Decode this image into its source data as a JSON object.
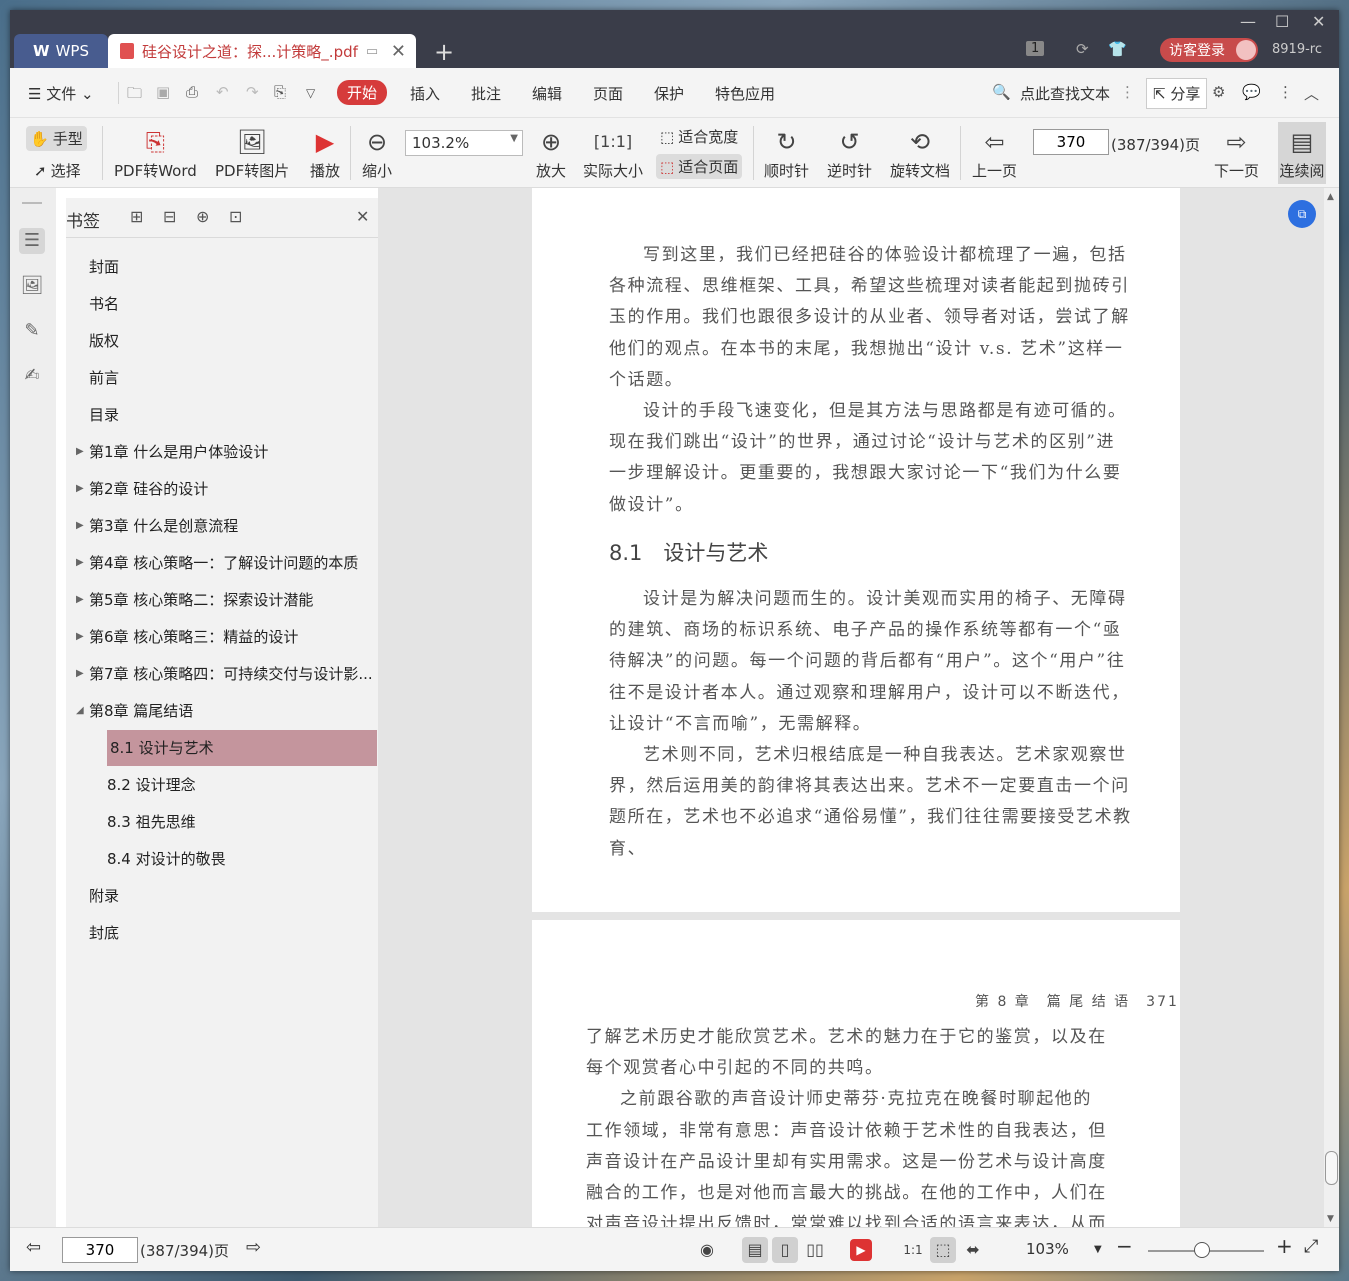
{
  "titlebar": {
    "wps_tab": "WPS",
    "doc_tab": "硅谷设计之道：探...计策略_.pdf",
    "badge": "1",
    "login": "访客登录",
    "user": "8919-rc"
  },
  "menu": {
    "file": "文件",
    "items": [
      "开始",
      "插入",
      "批注",
      "编辑",
      "页面",
      "保护",
      "特色应用"
    ],
    "search": "点此查找文本",
    "share": "分享"
  },
  "toolbar": {
    "hand": "手型",
    "select": "选择",
    "pdf2word": "PDF转Word",
    "pdf2img": "PDF转图片",
    "play": "播放",
    "zoom_out": "缩小",
    "zoom_value": "103.2%",
    "zoom_in": "放大",
    "actual_size": "实际大小",
    "fit_width": "适合宽度",
    "fit_page": "适合页面",
    "clockwise": "顺时针",
    "counter": "逆时针",
    "rotate": "旋转文档",
    "prev": "上一页",
    "page_num": "370",
    "page_total": "(387/394)页",
    "next": "下一页",
    "continuous": "连续阅"
  },
  "bookmark": {
    "title": "书签",
    "items": [
      {
        "label": "封面",
        "level": 0,
        "arrow": ""
      },
      {
        "label": "书名",
        "level": 0,
        "arrow": ""
      },
      {
        "label": "版权",
        "level": 0,
        "arrow": ""
      },
      {
        "label": "前言",
        "level": 0,
        "arrow": ""
      },
      {
        "label": "目录",
        "level": 0,
        "arrow": ""
      },
      {
        "label": "第1章 什么是用户体验设计",
        "level": 0,
        "arrow": "▶"
      },
      {
        "label": "第2章 硅谷的设计",
        "level": 0,
        "arrow": "▶"
      },
      {
        "label": "第3章 什么是创意流程",
        "level": 0,
        "arrow": "▶"
      },
      {
        "label": "第4章 核心策略一：了解设计问题的本质",
        "level": 0,
        "arrow": "▶"
      },
      {
        "label": "第5章 核心策略二：探索设计潜能",
        "level": 0,
        "arrow": "▶"
      },
      {
        "label": "第6章 核心策略三：精益的设计",
        "level": 0,
        "arrow": "▶"
      },
      {
        "label": "第7章 核心策略四：可持续交付与设计影...",
        "level": 0,
        "arrow": "▶"
      },
      {
        "label": "第8章 篇尾结语",
        "level": 0,
        "arrow": "◢"
      },
      {
        "label": "8.1 设计与艺术",
        "level": 1,
        "arrow": ""
      },
      {
        "label": "8.2 设计理念",
        "level": 1,
        "arrow": ""
      },
      {
        "label": "8.3 祖先思维",
        "level": 1,
        "arrow": ""
      },
      {
        "label": "8.4 对设计的敬畏",
        "level": 1,
        "arrow": ""
      },
      {
        "label": "附录",
        "level": 0,
        "arrow": ""
      },
      {
        "label": "封底",
        "level": 0,
        "arrow": ""
      }
    ]
  },
  "page1": {
    "para1": "写到这里，我们已经把硅谷的体验设计都梳理了一遍，包括各种流程、思维框架、工具，希望这些梳理对读者能起到抛砖引玉的作用。我们也跟很多设计的从业者、领导者对话，尝试了解他们的观点。在本书的末尾，我想抛出“设计 v.s. 艺术”这样一个话题。",
    "para2": "设计的手段飞速变化，但是其方法与思路都是有迹可循的。现在我们跳出“设计”的世界，通过讨论“设计与艺术的区别”进一步理解设计。更重要的，我想跟大家讨论一下“我们为什么要做设计”。",
    "heading": "8.1　设计与艺术",
    "para3": "设计是为解决问题而生的。设计美观而实用的椅子、无障碍的建筑、商场的标识系统、电子产品的操作系统等都有一个“亟待解决”的问题。每一个问题的背后都有“用户”。这个“用户”往往不是设计者本人。通过观察和理解用户，设计可以不断迭代，让设计“不言而喻”，无需解释。",
    "para4": "艺术则不同，艺术归根结底是一种自我表达。艺术家观察世界，然后运用美的韵律将其表达出来。艺术不一定要直击一个问题所在，艺术也不必追求“通俗易懂”，我们往往需要接受艺术教育、"
  },
  "page2": {
    "running_head": "第 8 章　篇 尾 结 语　371",
    "para1": "了解艺术历史才能欣赏艺术。艺术的魅力在于它的鉴赏，以及在每个观赏者心中引起的不同的共鸣。",
    "para2": "之前跟谷歌的声音设计师史蒂芬·克拉克在晚餐时聊起他的工作领域，非常有意思：声音设计依赖于艺术性的自我表达，但声音设计在产品设计里却有实用需求。这是一份艺术与设计高度融合的工作，也是对他而言最大的挑战。在他的工作中，人们在对声音设计提出反馈时，常常难以找到合适的语言来表达，从而很难客观地"
  },
  "status": {
    "page_num": "370",
    "page_total": "(387/394)页",
    "zoom": "103%"
  }
}
